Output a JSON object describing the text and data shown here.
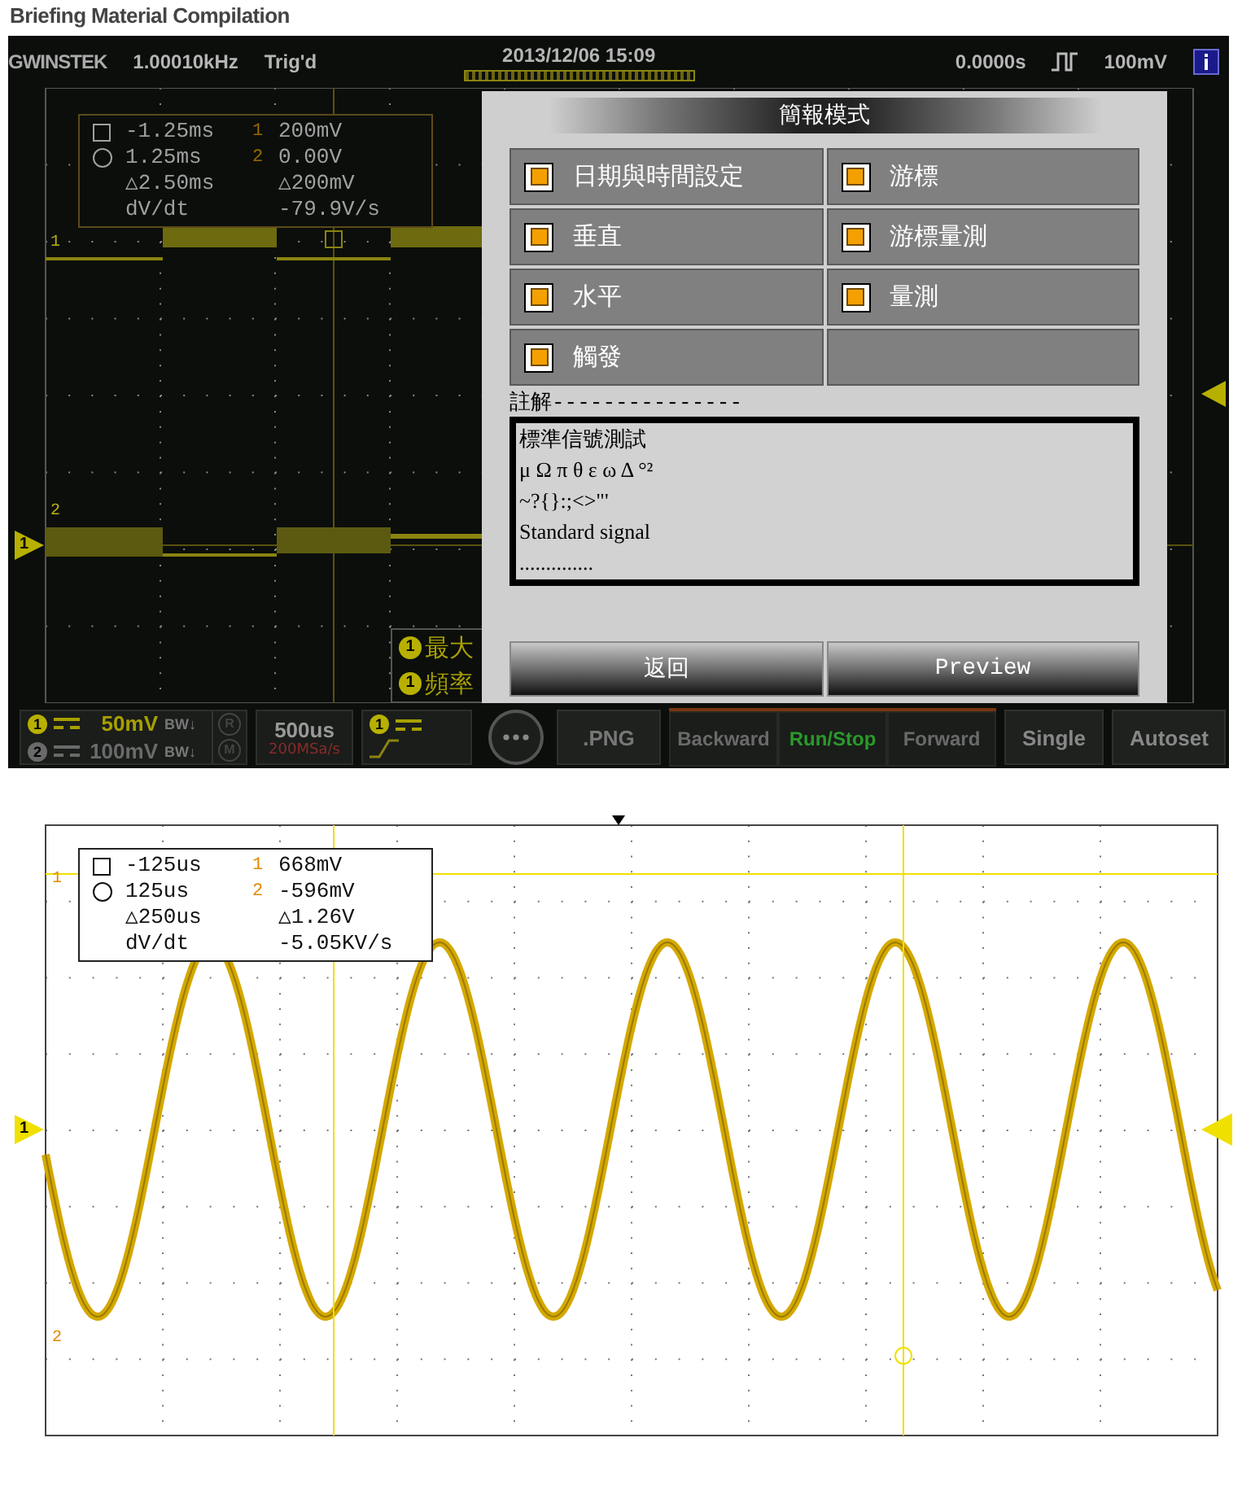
{
  "page_title": "Briefing Material Compilation",
  "scope_display": {
    "top_bar": {
      "brand": "GWINSTEK",
      "frequency": "1.00010kHz",
      "trigger_status": "Trig'd",
      "datetime": "2013/12/06  15:09",
      "time_offset": "0.0000s",
      "trigger_level": "100mV"
    },
    "cursor_readout": {
      "rows": [
        {
          "kind": "h1",
          "time": "-1.25ms",
          "channel": "1",
          "value": "200mV"
        },
        {
          "kind": "h2",
          "time": "1.25ms",
          "channel": "2",
          "value": "0.00V"
        },
        {
          "kind": "delta",
          "time": "△2.50ms",
          "value": "△200mV"
        },
        {
          "kind": "slope",
          "time": "dV/dt",
          "value": "-79.9V/s"
        }
      ]
    },
    "cursor_labels": [
      "1",
      "2"
    ],
    "channel_marker": "1",
    "measurements": [
      {
        "channel": "1",
        "label": "最大"
      },
      {
        "channel": "1",
        "label": "頻率"
      }
    ],
    "dialog": {
      "title": "簡報模式",
      "options": [
        {
          "label": "日期與時間設定",
          "checked": true
        },
        {
          "label": "游標",
          "checked": true
        },
        {
          "label": "垂直",
          "checked": true
        },
        {
          "label": "游標量測",
          "checked": true
        },
        {
          "label": "水平",
          "checked": true
        },
        {
          "label": "量測",
          "checked": true
        },
        {
          "label": "觸發",
          "checked": true
        }
      ],
      "note_label": "註解---------------",
      "note_lines": [
        "標準信號測試",
        "μ Ω π θ ε ω Δ °²",
        "~?{}:;<>\"'",
        "Standard signal",
        ".............."
      ],
      "buttons": [
        "返回",
        "Preview"
      ]
    },
    "bottom_bar": {
      "channels": [
        {
          "channel": "1",
          "scale": "50mV",
          "bandwidth": "BW↓",
          "active": true
        },
        {
          "channel": "2",
          "scale": "100mV",
          "bandwidth": "BW↓",
          "active": false
        }
      ],
      "side_keys": [
        "R",
        "M"
      ],
      "timebase": "500us",
      "sample_rate": "200MSa/s",
      "trigger_channel": "1",
      "save_format": ".PNG",
      "transport": [
        {
          "label": "Backward",
          "active": false
        },
        {
          "label": "Run/Stop",
          "active": true
        },
        {
          "label": "Forward",
          "active": false
        }
      ],
      "buttons": [
        "Single",
        "Autoset"
      ]
    }
  },
  "sine_display": {
    "cursor_readout": {
      "rows": [
        {
          "kind": "h1",
          "time": "-125us",
          "channel": "1",
          "value": "668mV"
        },
        {
          "kind": "h2",
          "time": "125us",
          "channel": "2",
          "value": "-596mV"
        },
        {
          "kind": "delta",
          "time": "△250us",
          "value": "△1.26V"
        },
        {
          "kind": "slope",
          "time": "dV/dt",
          "value": "-5.05KV/s"
        }
      ]
    },
    "cursor_labels": [
      "1",
      "2"
    ],
    "channel_marker": "1"
  }
}
